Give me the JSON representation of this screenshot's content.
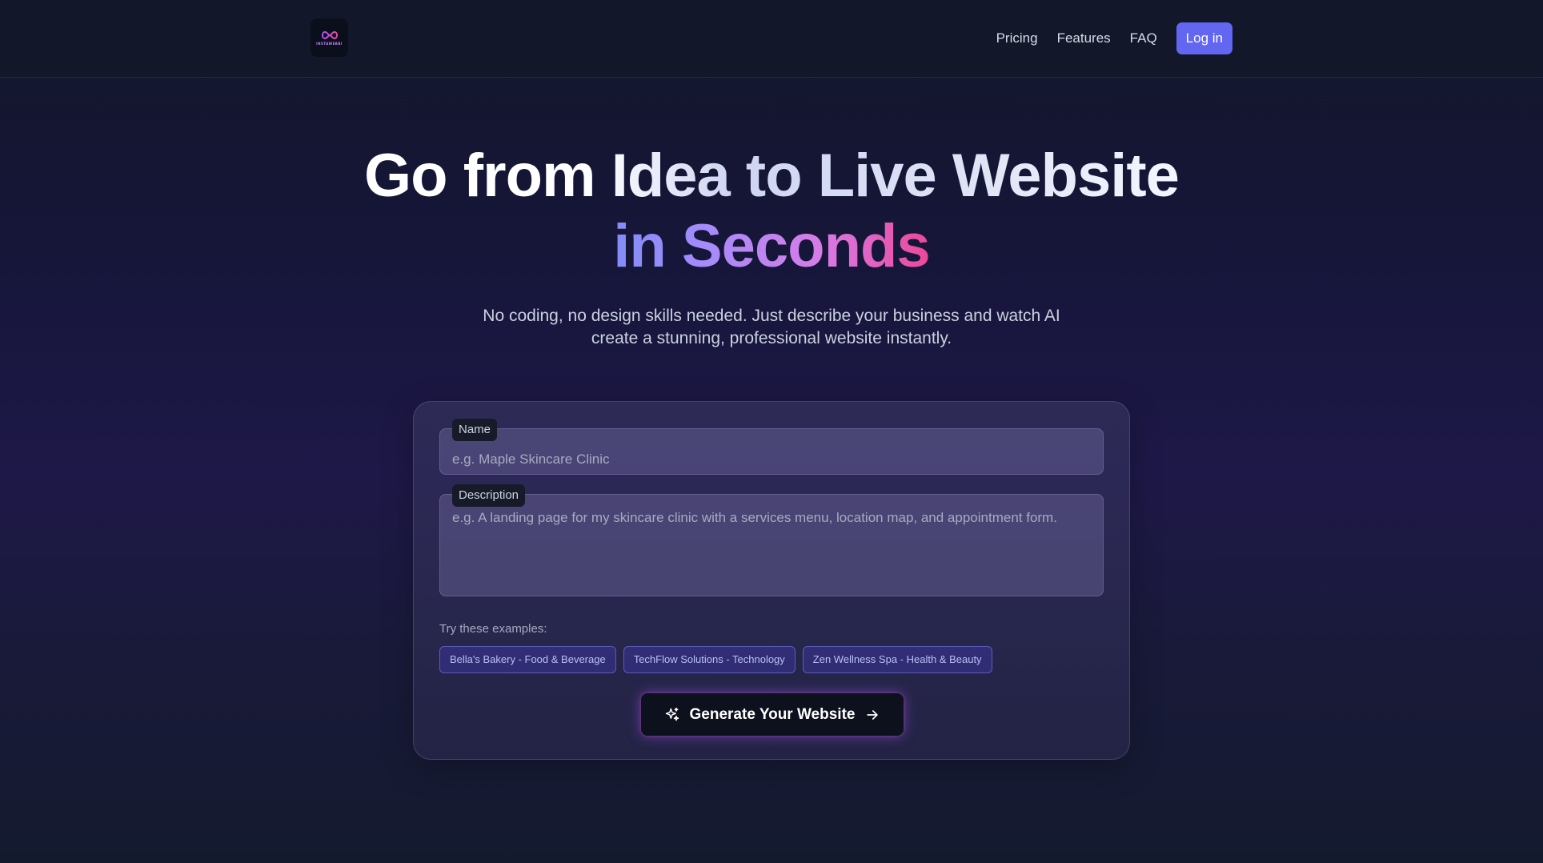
{
  "header": {
    "logo_text": "INSTAWEBBI",
    "nav_items": [
      "Pricing",
      "Features",
      "FAQ"
    ],
    "login_label": "Log in",
    "accent_color": "#6366f1"
  },
  "hero": {
    "title_line1": "Go from Idea to Live Website",
    "title_line2": "in Seconds",
    "subtitle_line1": "No coding, no design skills needed. Just describe your business and watch AI",
    "subtitle_line2": "create a stunning, professional website instantly."
  },
  "form": {
    "name_label": "Name",
    "name_placeholder": "e.g. Maple Skincare Clinic",
    "name_value": "",
    "description_label": "Description",
    "description_placeholder": "e.g. A landing page for my skincare clinic with a services menu, location map, and appointment form.",
    "description_value": "",
    "examples_label": "Try these examples:",
    "examples": [
      "Bella's Bakery - Food & Beverage",
      "TechFlow Solutions - Technology",
      "Zen Wellness Spa - Health & Beauty"
    ],
    "generate_label": "Generate Your Website",
    "generate_icon": "sparkles-icon",
    "generate_trailing_icon": "arrow-right-icon"
  }
}
